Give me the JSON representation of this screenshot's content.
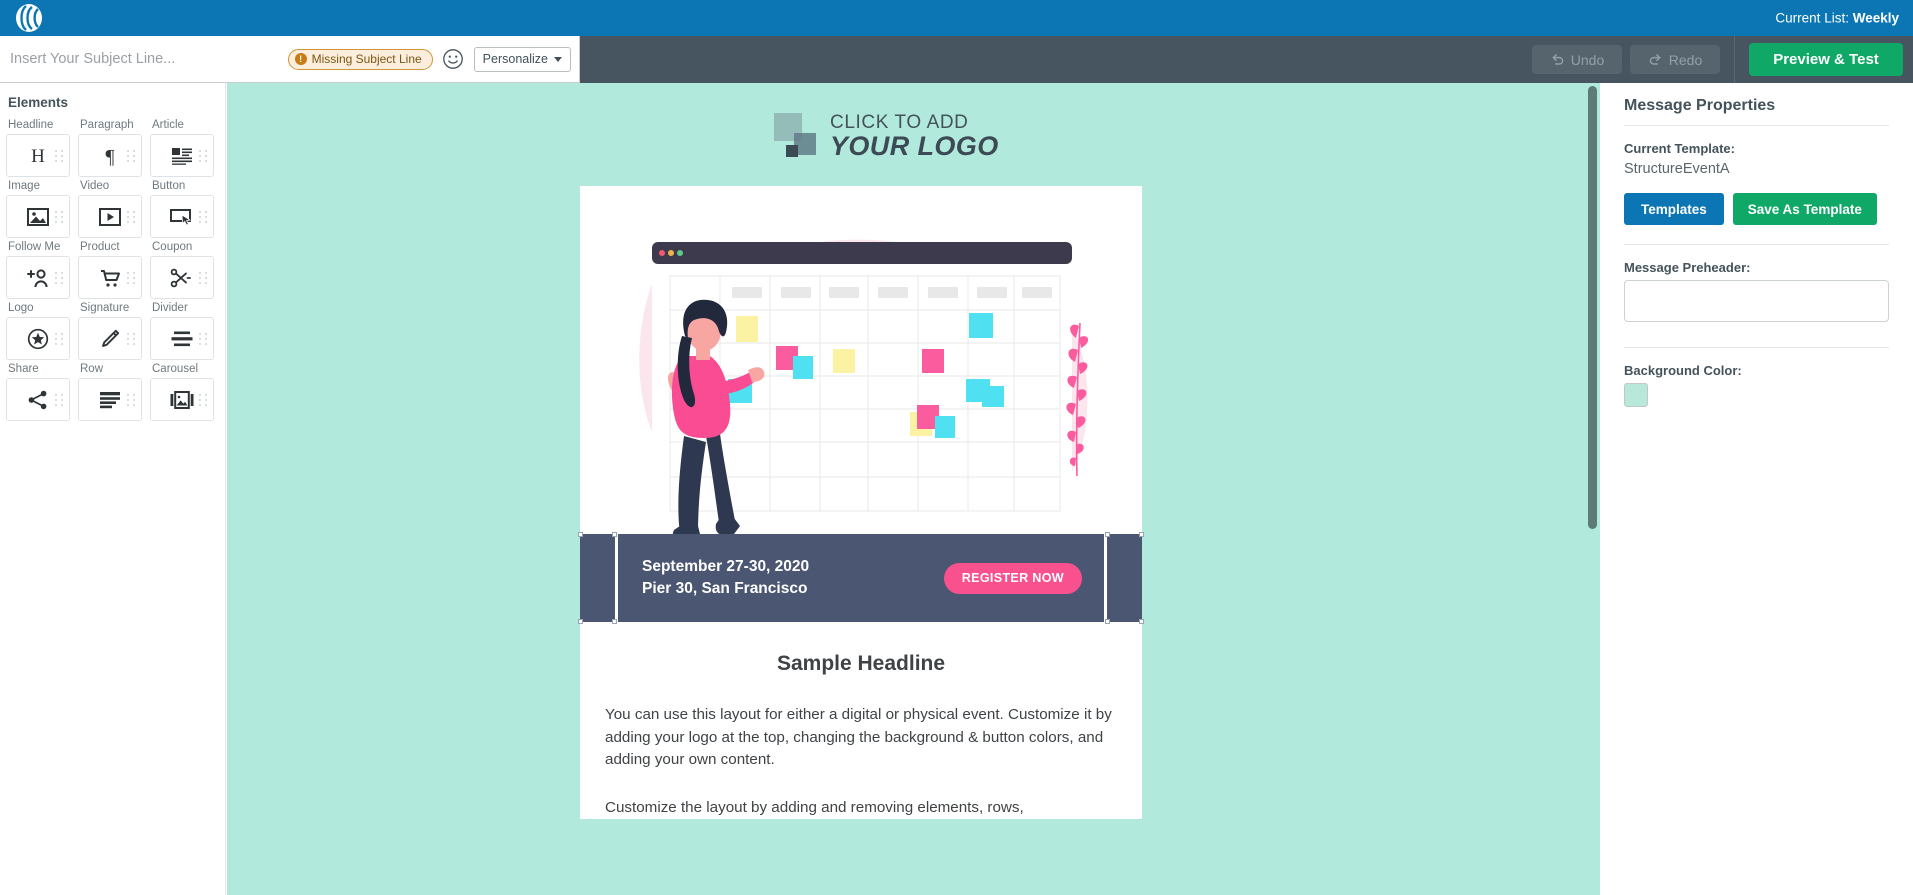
{
  "brand": {
    "logo_icon": "wave-circle-logo",
    "current_list_label": "Current List:",
    "current_list_value": "Weekly"
  },
  "toolbar": {
    "subject_placeholder": "Insert Your Subject Line...",
    "subject_value": "",
    "missing_subject_badge": "Missing Subject Line",
    "missing_subject_icon": "alert-exclamation-icon",
    "emoji_icon": "smiley-face-icon",
    "personalize_label": "Personalize",
    "personalize_caret_icon": "chevron-down-icon",
    "undo_label": "Undo",
    "undo_icon": "undo-arrow-icon",
    "redo_label": "Redo",
    "redo_icon": "redo-arrow-icon",
    "preview_test_label": "Preview & Test"
  },
  "sidebar": {
    "title": "Elements",
    "items": [
      {
        "label": "Headline",
        "icon": "headline-h-icon"
      },
      {
        "label": "Paragraph",
        "icon": "paragraph-pilcrow-icon"
      },
      {
        "label": "Article",
        "icon": "article-layout-icon"
      },
      {
        "label": "Image",
        "icon": "image-picture-icon"
      },
      {
        "label": "Video",
        "icon": "video-play-icon"
      },
      {
        "label": "Button",
        "icon": "button-cursor-icon"
      },
      {
        "label": "Follow Me",
        "icon": "follow-person-plus-icon"
      },
      {
        "label": "Product",
        "icon": "product-cart-icon"
      },
      {
        "label": "Coupon",
        "icon": "coupon-scissors-icon"
      },
      {
        "label": "Logo",
        "icon": "logo-star-badge-icon"
      },
      {
        "label": "Signature",
        "icon": "signature-pen-icon"
      },
      {
        "label": "Divider",
        "icon": "divider-lines-icon"
      },
      {
        "label": "Share",
        "icon": "share-nodes-icon"
      },
      {
        "label": "Row",
        "icon": "row-stack-icon"
      },
      {
        "label": "Carousel",
        "icon": "carousel-image-icon"
      }
    ]
  },
  "canvas": {
    "background_color": "#b1e9dc",
    "logo_placeholder": {
      "line1": "CLICK TO ADD",
      "line2": "YOUR LOGO",
      "icon": "logo-placeholder-squares-icon"
    },
    "hero": {
      "icon": "woman-with-calendar-board-illustration",
      "alt": "Illustration of a woman placing colored sticky notes on a calendar board"
    },
    "banner": {
      "date_line": "September 27-30, 2020",
      "venue_line": "Pier 30, San Francisco",
      "cta_label": "REGISTER NOW",
      "cta_color": "#f9508e",
      "background_color": "#4b5672"
    },
    "body": {
      "headline": "Sample Headline",
      "paragraph1": "You can use this layout for either a digital or physical event. Customize it by adding your logo at the top, changing the background & button colors, and adding your own content.",
      "paragraph2": "Customize the layout by adding and removing elements, rows,"
    }
  },
  "properties": {
    "title": "Message Properties",
    "current_template_label": "Current Template:",
    "current_template_value": "StructureEventA",
    "templates_button": "Templates",
    "save_as_template_button": "Save As Template",
    "preheader_label": "Message Preheader:",
    "preheader_value": "",
    "background_color_label": "Background Color:",
    "background_color_value": "#b8e8d9"
  }
}
